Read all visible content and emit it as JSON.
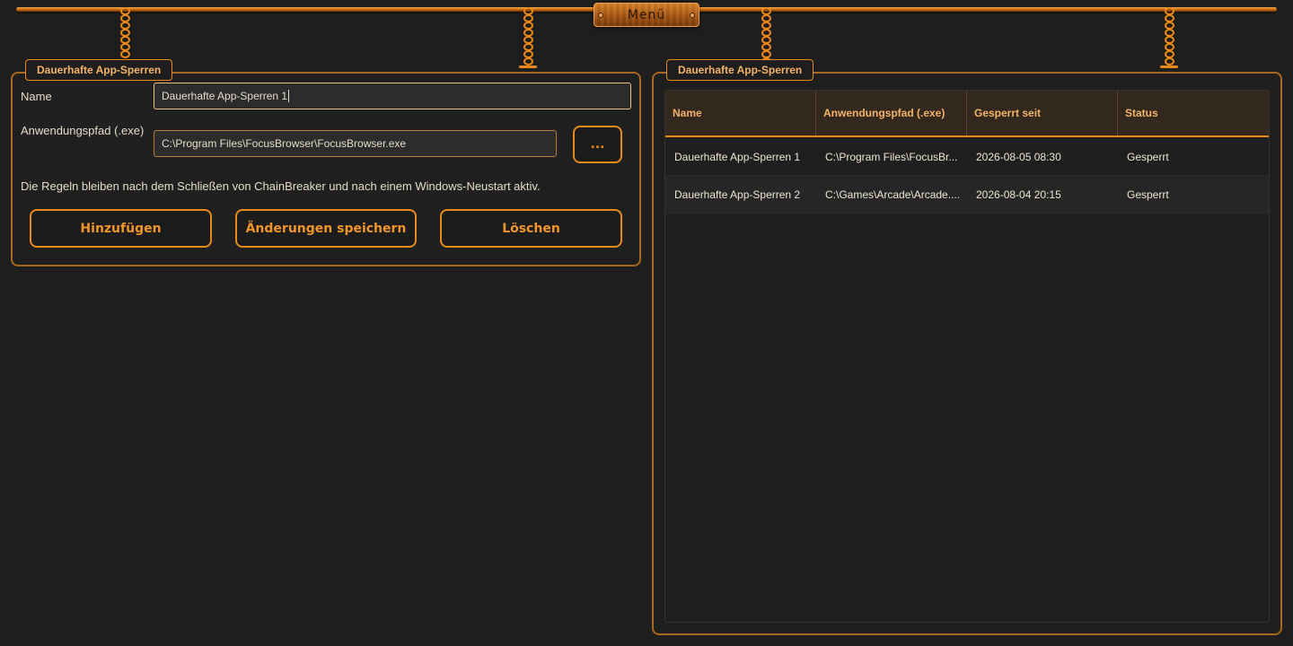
{
  "menu": {
    "label": "Menü"
  },
  "left_panel": {
    "title": "Dauerhafte App-Sperren",
    "name_label": "Name",
    "name_value": "Dauerhafte App-Sperren 1",
    "path_label": "Anwendungspfad (.exe)",
    "path_value": "C:\\Program Files\\FocusBrowser\\FocusBrowser.exe",
    "browse_label": "...",
    "hint": "Die Regeln bleiben nach dem Schließen von ChainBreaker und nach einem Windows-Neustart aktiv.",
    "buttons": {
      "add": "Hinzufügen",
      "save": "Änderungen speichern",
      "delete": "Löschen"
    }
  },
  "right_panel": {
    "title": "Dauerhafte App-Sperren",
    "columns": [
      "Name",
      "Anwendungspfad (.exe)",
      "Gesperrt seit",
      "Status"
    ],
    "rows": [
      [
        "Dauerhafte App-Sperren 1",
        "C:\\Program Files\\FocusBr...",
        "2026-08-05 08:30",
        "Gesperrt"
      ],
      [
        "Dauerhafte App-Sperren 2",
        "C:\\Games\\Arcade\\Arcade....",
        "2026-08-04 20:15",
        "Gesperrt"
      ]
    ]
  },
  "colors": {
    "accent": "#e88a1a",
    "background": "#1e1e1e",
    "panel_border": "#a7671f",
    "header_bg": "#33281d"
  }
}
